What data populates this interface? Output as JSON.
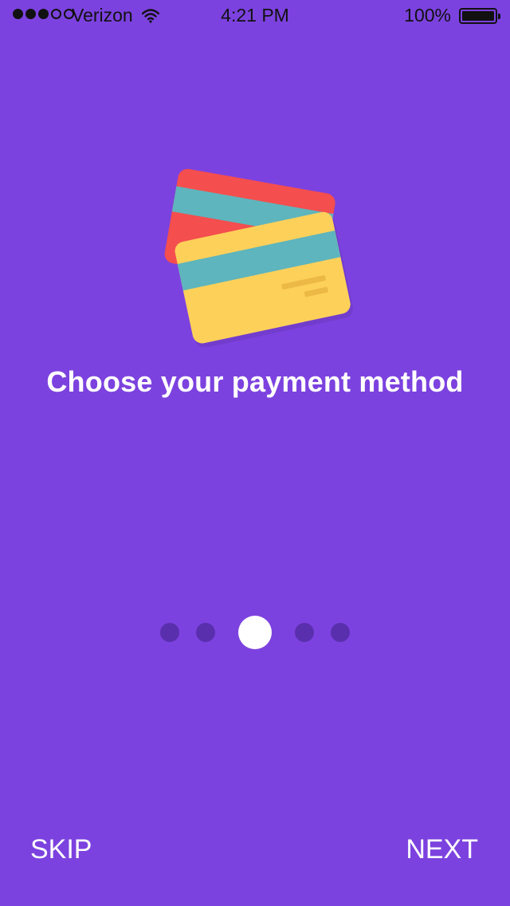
{
  "status_bar": {
    "carrier": "Verizon",
    "time": "4:21 PM",
    "battery": "100%",
    "signal_bars_filled": 3,
    "signal_bars_total": 5,
    "battery_level": 1.0
  },
  "onboarding": {
    "title": "Choose your payment method",
    "illustration_icon": "credit-cards-icon",
    "page_count": 5,
    "current_page": 3,
    "skip_label": "SKIP",
    "next_label": "NEXT"
  },
  "colors": {
    "background": "#7c42df",
    "dot_inactive": "#5a2fae",
    "dot_active": "#ffffff",
    "card_back": "#f44e4e",
    "card_front": "#fdd05a",
    "card_stripe": "#5eb5bd"
  }
}
